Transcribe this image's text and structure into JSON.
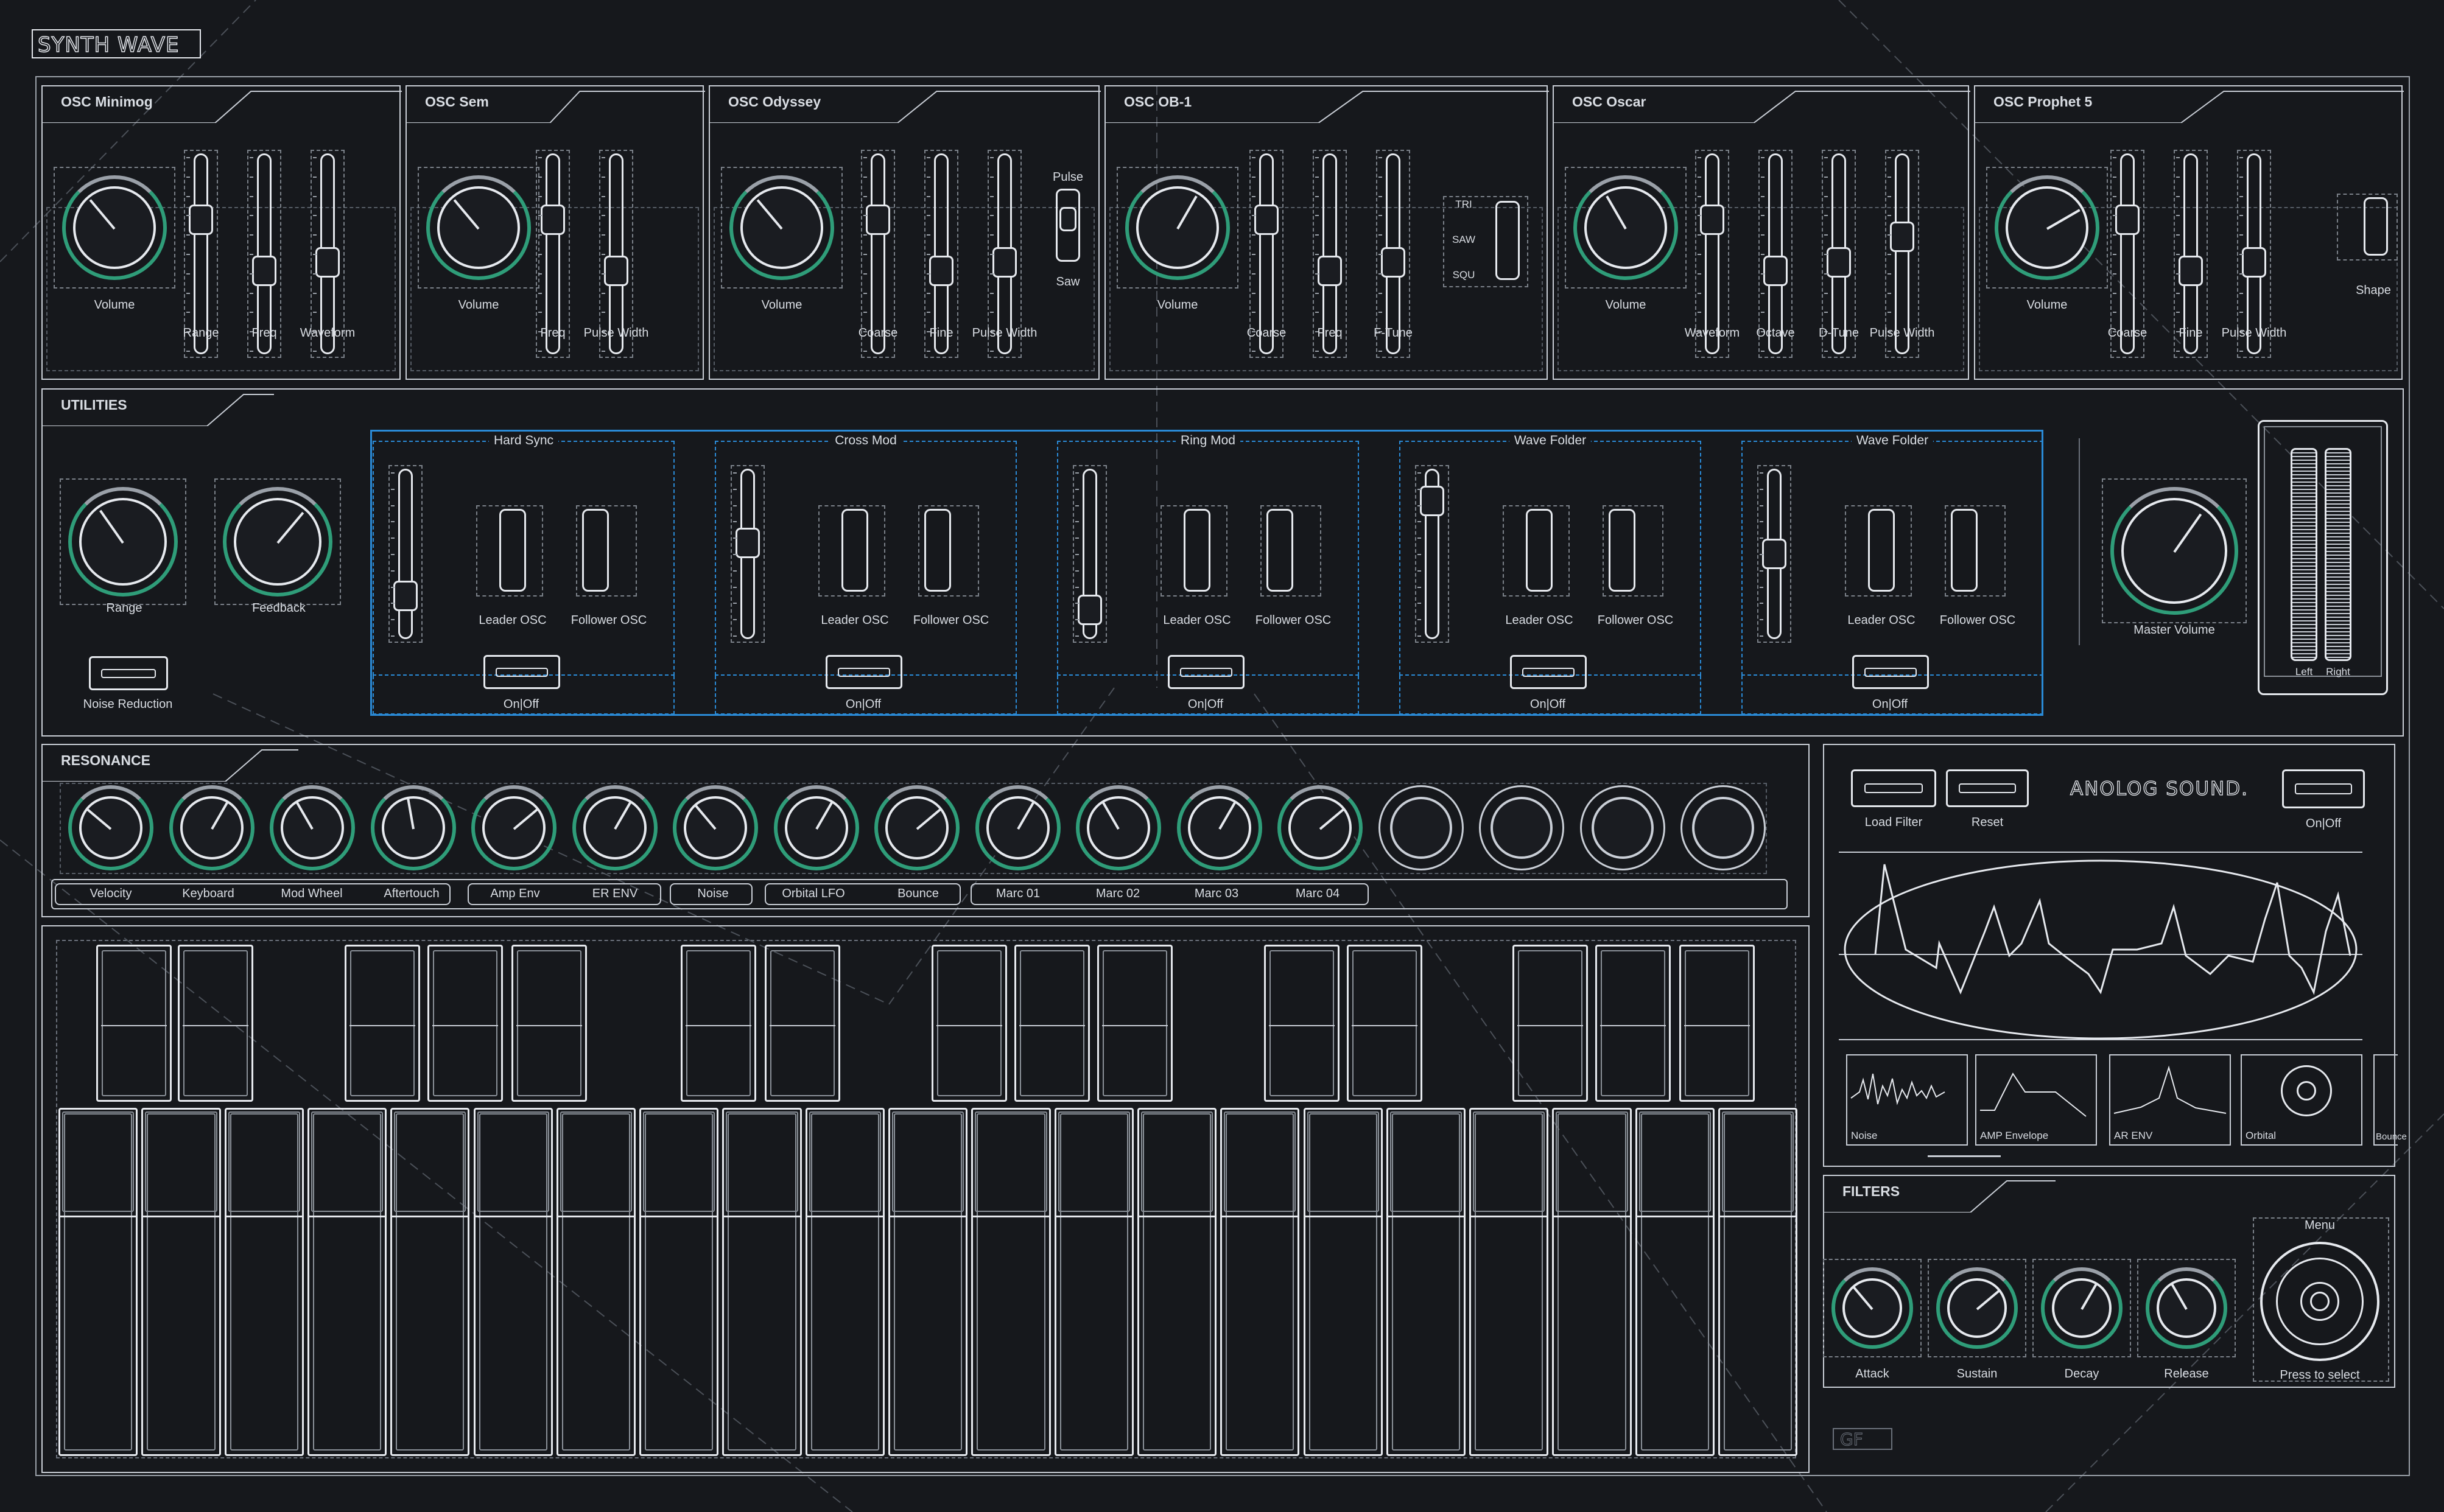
{
  "app": {
    "logo_text": "SYNTH WAVE",
    "bottom_logo_text": "GF"
  },
  "oscillators": [
    {
      "title": "OSC Minimog",
      "knob_label": "Volume",
      "slider_labels": [
        "Range",
        "Freq",
        "Waveform"
      ]
    },
    {
      "title": "OSC Sem",
      "knob_label": "Volume",
      "slider_labels": [
        "Freq",
        "Pulse Width"
      ]
    },
    {
      "title": "OSC Odyssey",
      "knob_label": "Volume",
      "slider_labels": [
        "Coarse",
        "Fine",
        "Pulse Width"
      ],
      "switch_labels": [
        "Pulse",
        "Saw"
      ]
    },
    {
      "title": "OSC OB-1",
      "knob_label": "Volume",
      "slider_labels": [
        "Coarse",
        "Freq",
        "F-Tune"
      ],
      "switch_labels": [
        "TRI",
        "SAW",
        "SQU"
      ]
    },
    {
      "title": "OSC Oscar",
      "knob_label": "Volume",
      "slider_labels": [
        "Waveform",
        "Octave",
        "D-Tune",
        "Pulse Width"
      ]
    },
    {
      "title": "OSC Prophet 5",
      "knob_label": "Volume",
      "slider_labels": [
        "Coarse",
        "Fine",
        "Pulse Width"
      ],
      "switch_label": "Shape"
    }
  ],
  "utilities": {
    "title": "UTILITIES",
    "knobs": [
      "Range",
      "Feedback"
    ],
    "noise_reduction_label": "Noise Reduction",
    "sections": [
      {
        "title": "Hard Sync",
        "leader": "Leader OSC",
        "follower": "Follower OSC",
        "toggle": "On|Off"
      },
      {
        "title": "Cross Mod",
        "leader": "Leader OSC",
        "follower": "Follower OSC",
        "toggle": "On|Off"
      },
      {
        "title": "Ring Mod",
        "leader": "Leader OSC",
        "follower": "Follower OSC",
        "toggle": "On|Off"
      },
      {
        "title": "Wave Folder",
        "leader": "Leader OSC",
        "follower": "Follower OSC",
        "toggle": "On|Off"
      },
      {
        "title": "Wave Folder",
        "leader": "Leader OSC",
        "follower": "Follower OSC",
        "toggle": "On|Off"
      }
    ],
    "master_volume_label": "Master Volume",
    "meter_labels": [
      "Left",
      "Right"
    ]
  },
  "resonance": {
    "title": "RESONANCE",
    "knob_count": 17,
    "groups": [
      {
        "labels": [
          "Velocity",
          "Keyboard",
          "Mod Wheel",
          "Aftertouch"
        ]
      },
      {
        "labels": [
          "Amp Env",
          "ER ENV"
        ]
      },
      {
        "labels": [
          "Noise"
        ]
      },
      {
        "labels": [
          "Orbital LFO",
          "Bounce"
        ]
      },
      {
        "labels": [
          "Marc 01",
          "Marc 02",
          "Marc 03",
          "Marc 04"
        ]
      }
    ]
  },
  "display": {
    "load_filter": "Load Filter",
    "reset": "Reset",
    "brand": "ANOLOG SOUND.",
    "on_off": "On|Off",
    "thumbnails": [
      "Noise",
      "AMP Envelope",
      "AR ENV",
      "Orbital",
      "Bounce"
    ]
  },
  "filters": {
    "title": "FILTERS",
    "knobs": [
      "Attack",
      "Sustain",
      "Decay",
      "Release"
    ],
    "menu_label": "Menu",
    "menu_hint": "Press to select"
  },
  "slider_scale": [
    "0",
    "1",
    "2",
    "3",
    "4",
    "5",
    "6",
    "7",
    "8",
    "9",
    "10"
  ],
  "colors": {
    "background": "#16181c",
    "line": "#e6e9ee",
    "accent_green": "#2f9d79",
    "accent_blue": "#2a8ad6"
  }
}
